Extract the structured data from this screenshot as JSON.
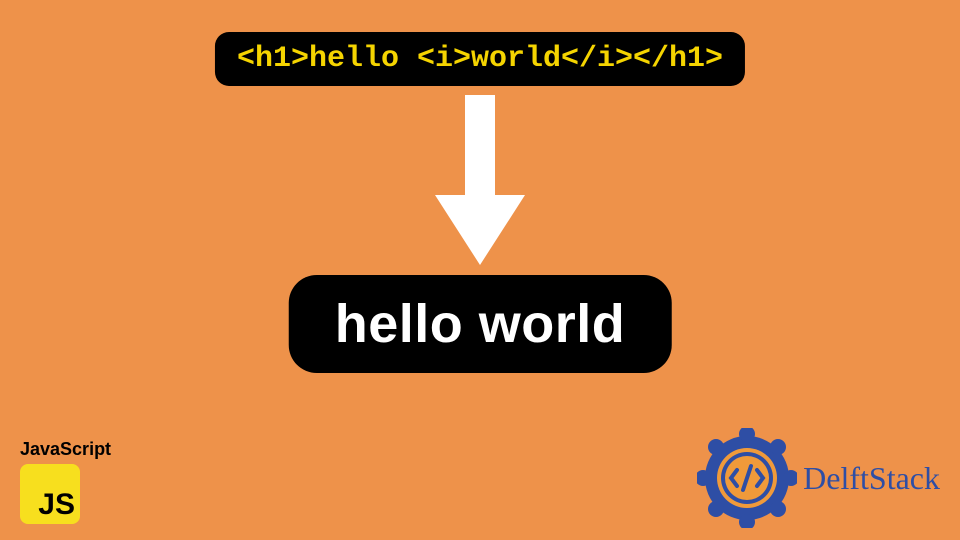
{
  "code_box": "<h1>hello <i>world</i></h1>",
  "result_box": "hello world",
  "js_label": "JavaScript",
  "js_tile": "JS",
  "brand_name_1": "Delft",
  "brand_name_2": "Stack",
  "colors": {
    "background": "#ee924a",
    "code_bg": "#000000",
    "code_fg": "#f5d400",
    "result_bg": "#000000",
    "result_fg": "#ffffff",
    "arrow": "#ffffff",
    "js_tile": "#f7df1e",
    "brand": "#2e4ea5"
  }
}
